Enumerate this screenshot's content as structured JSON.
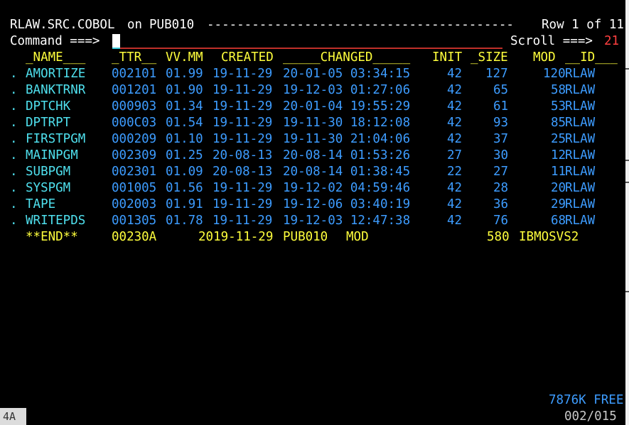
{
  "header": {
    "dataset": "RLAW.SRC.COBOL",
    "on_word": "on",
    "volume": "PUB010",
    "dashes": "-----------------------------------------",
    "row_info": "Row 1 of 11"
  },
  "command": {
    "label": "Command ===>",
    "value": "",
    "scroll_label": "Scroll ===>",
    "scroll_value": "21"
  },
  "columns": {
    "name": "_NAME___",
    "ttr": "_TTR__",
    "vvmm": "VV.MM",
    "created": "CREATED",
    "changed": "_____CHANGED_____",
    "init": "INIT",
    "size": "_SIZE",
    "mod": "MOD",
    "id": "__ID___"
  },
  "members": [
    {
      "sel": ".",
      "name": "AMORTIZE",
      "ttr": "002101",
      "vvmm": "01.99",
      "created": "19-11-29",
      "changed": "20-01-05 03:34:15",
      "init": "42",
      "size": "127",
      "mod": "120",
      "id": "RLAW"
    },
    {
      "sel": ".",
      "name": "BANKTRNR",
      "ttr": "001201",
      "vvmm": "01.90",
      "created": "19-11-29",
      "changed": "19-12-03 01:27:06",
      "init": "42",
      "size": "65",
      "mod": "58",
      "id": "RLAW"
    },
    {
      "sel": ".",
      "name": "DPTCHK",
      "ttr": "000903",
      "vvmm": "01.34",
      "created": "19-11-29",
      "changed": "20-01-04 19:55:29",
      "init": "42",
      "size": "61",
      "mod": "53",
      "id": "RLAW"
    },
    {
      "sel": ".",
      "name": "DPTRPT",
      "ttr": "000C03",
      "vvmm": "01.54",
      "created": "19-11-29",
      "changed": "19-11-30 18:12:08",
      "init": "42",
      "size": "93",
      "mod": "85",
      "id": "RLAW"
    },
    {
      "sel": ".",
      "name": "FIRSTPGM",
      "ttr": "000209",
      "vvmm": "01.10",
      "created": "19-11-29",
      "changed": "19-11-30 21:04:06",
      "init": "42",
      "size": "37",
      "mod": "25",
      "id": "RLAW"
    },
    {
      "sel": ".",
      "name": "MAINPGM",
      "ttr": "002309",
      "vvmm": "01.25",
      "created": "20-08-13",
      "changed": "20-08-14 01:53:26",
      "init": "27",
      "size": "30",
      "mod": "12",
      "id": "RLAW"
    },
    {
      "sel": ".",
      "name": "SUBPGM",
      "ttr": "002301",
      "vvmm": "01.09",
      "created": "20-08-13",
      "changed": "20-08-14 01:38:45",
      "init": "22",
      "size": "27",
      "mod": "11",
      "id": "RLAW"
    },
    {
      "sel": ".",
      "name": "SYSPGM",
      "ttr": "001005",
      "vvmm": "01.56",
      "created": "19-11-29",
      "changed": "19-12-02 04:59:46",
      "init": "42",
      "size": "28",
      "mod": "20",
      "id": "RLAW"
    },
    {
      "sel": ".",
      "name": "TAPE",
      "ttr": "002003",
      "vvmm": "01.91",
      "created": "19-11-29",
      "changed": "19-12-06 03:40:19",
      "init": "42",
      "size": "36",
      "mod": "29",
      "id": "RLAW"
    },
    {
      "sel": ".",
      "name": "WRITEPDS",
      "ttr": "001305",
      "vvmm": "01.78",
      "created": "19-11-29",
      "changed": "19-12-03 12:47:38",
      "init": "42",
      "size": "76",
      "mod": "68",
      "id": "RLAW"
    }
  ],
  "end_row": {
    "name": "**END**",
    "ttr": "00230A",
    "date": "2019-11-29",
    "volume": "PUB010",
    "mod_word": "MOD",
    "size": "580",
    "system": "IBMOSVS2"
  },
  "footer": {
    "free": "7876K FREE",
    "position": "002/015",
    "session": "4A"
  },
  "colors": {
    "background": "#000000",
    "white": "#ffffff",
    "yellow": "#ffff3c",
    "blue": "#3d9cff",
    "turquoise": "#4fe0ee",
    "red": "#ff4040"
  }
}
